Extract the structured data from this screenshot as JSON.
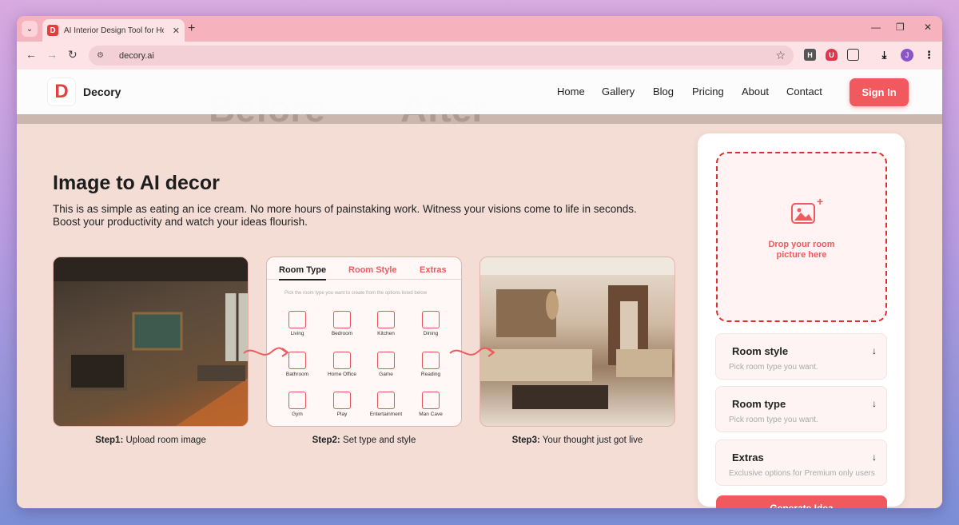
{
  "browser": {
    "tab_title": "AI Interior Design Tool for Hom",
    "favicon_letter": "D",
    "url": "decory.ai",
    "ext_h": "H",
    "avatar_letter": "J"
  },
  "header": {
    "brand": "Decory",
    "logo_letter": "D",
    "nav": [
      "Home",
      "Gallery",
      "Blog",
      "Pricing",
      "About",
      "Contact"
    ],
    "sign_in": "Sign In",
    "hero_ghost": [
      "Before",
      "After"
    ]
  },
  "main": {
    "title": "Image to AI decor",
    "description": "This is as simple as eating an ice cream. No more hours of painstaking work. Witness your visions come to life in seconds. Boost your productivity and watch your ideas flourish.",
    "panel": {
      "tabs": [
        "Room Type",
        "Room Style",
        "Extras"
      ],
      "note": "Pick the room type you want to create from the options listed below",
      "items": [
        "Living",
        "Bedroom",
        "Kitchen",
        "Dining",
        "Bathroom",
        "Home Office",
        "Game",
        "Reading",
        "Gym",
        "Play",
        "Entertainment",
        "Man Cave"
      ]
    },
    "steps": [
      {
        "num": "Step1:",
        "text": " Upload room image"
      },
      {
        "num": "Step2:",
        "text": " Set type and style"
      },
      {
        "num": "Step3:",
        "text": " Your thought just got live"
      }
    ]
  },
  "side": {
    "drop_text_1": "Drop your room",
    "drop_text_2": "picture here",
    "selects": [
      {
        "title": "Room style",
        "placeholder": "Pick room type you want."
      },
      {
        "title": "Room type",
        "placeholder": "Pick room type you want."
      },
      {
        "title": "Extras",
        "placeholder": "Exclusive options for Premium only users"
      }
    ],
    "generate": "Generate Idea"
  },
  "colors": {
    "accent": "#f05a5e",
    "tab_strip": "#f6b3bd",
    "page_bg": "#f3ddd5"
  }
}
